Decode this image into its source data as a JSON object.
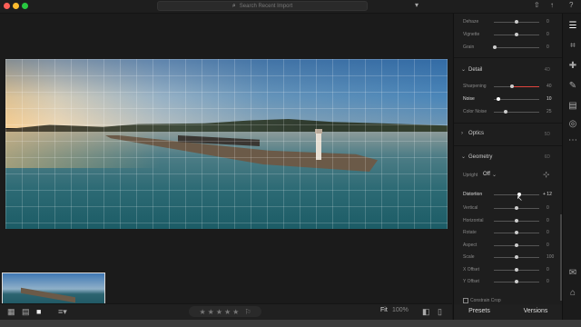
{
  "search": {
    "placeholder": "Search Recent Import"
  },
  "panel": {
    "effects_rows": [
      {
        "label": "Dehaze",
        "value": "0",
        "fraction": 0.5
      },
      {
        "label": "Vignette",
        "value": "0",
        "fraction": 0.5
      },
      {
        "label": "Grain",
        "value": "0",
        "fraction": 0.02
      }
    ],
    "detail": {
      "title": "Detail",
      "hint": "4D",
      "rows": [
        {
          "label": "Sharpening",
          "value": "40",
          "fraction": 0.4
        },
        {
          "label": "Noise",
          "value": "10",
          "fraction": 0.1
        },
        {
          "label": "Color Noise",
          "value": "25",
          "fraction": 0.25
        }
      ]
    },
    "optics": {
      "title": "Optics",
      "hint": "5D"
    },
    "geometry": {
      "title": "Geometry",
      "hint": "6D",
      "upright_label": "Upright",
      "upright_value": "Off",
      "distortion_label": "Distortion",
      "distortion_value": "+ 12",
      "distortion_fraction": 0.56,
      "rows": [
        {
          "label": "Vertical",
          "value": "0",
          "fraction": 0.5
        },
        {
          "label": "Horizontal",
          "value": "0",
          "fraction": 0.5
        },
        {
          "label": "Rotate",
          "value": "0",
          "fraction": 0.5
        },
        {
          "label": "Aspect",
          "value": "0",
          "fraction": 0.5
        },
        {
          "label": "Scale",
          "value": "100",
          "fraction": 0.5
        },
        {
          "label": "X Offset",
          "value": "0",
          "fraction": 0.5
        },
        {
          "label": "Y Offset",
          "value": "0",
          "fraction": 0.5
        }
      ],
      "constrain_label": "Constrain Crop"
    }
  },
  "bottombar": {
    "fit_label": "Fit",
    "zoom_value": "100%"
  },
  "footer": {
    "presets_label": "Presets",
    "versions_label": "Versions"
  },
  "colors": {
    "accent_red": "#e0443e",
    "panel_bg": "#1e1e1e"
  },
  "icons": {
    "rail": [
      "sliders-icon",
      "crop-icon",
      "bandage-icon",
      "brush-icon",
      "gradient-icon",
      "radial-icon",
      "more-icon",
      "chat-icon",
      "tag-icon"
    ]
  }
}
